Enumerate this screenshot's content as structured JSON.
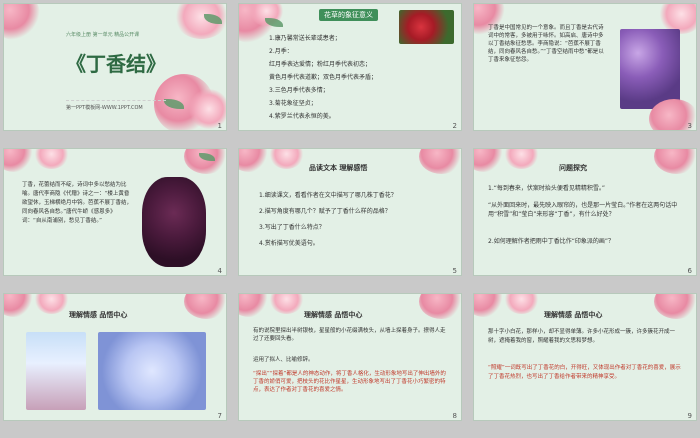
{
  "slides": {
    "s1": {
      "num": "1",
      "subtitle": "六年级上册 第一单元 精品公开课",
      "title": "《丁香结》",
      "footer": "第一PPT模板网-WWW.1PPT.COM"
    },
    "s2": {
      "num": "2",
      "tag": "花草的象征意义",
      "lines": [
        "1.康乃馨常送长辈或患者；",
        "2.月季：",
        "红月季表达爱情；粉红月季代表初恋；",
        "黄色月季代表道歉；双色月季代表矛盾；",
        "3.三色月季代表多情；",
        "3.菊花象征坚贞；",
        "4.紫罗兰代表永恒的美。"
      ]
    },
    "s3": {
      "num": "3",
      "text": "丁香是中国常见的一个意象。而且丁香是古代诗词中的常客，多被用于咏怀。如高启、唐诗中多以丁香结象征愁思。李商隐说：“芭蕉不展丁香结，同向春风各自愁。”“丁香空结雨中愁”都是以丁香来象征愁怨。"
    },
    "s4": {
      "num": "4",
      "text": "丁香，花蕾结而不绽，诗词中多以愁结为比喻。唐代李商隐《代赠》诗之一：“楼上黄昏欲望休，玉梯横绝月中钩。芭蕉不展丁香结，同向春风各自愁。”唐代牛峤《感恩多》词：“自从南浦别，愁见丁香结。”"
    },
    "s5": {
      "num": "5",
      "heading": "品读文本 理解感悟",
      "lines": [
        "1.细读课文，看看作者在文中描写了哪几株丁香花？",
        "2.描写角度有哪几个？赋予了丁香什么样的品格？",
        "3.写出了丁香什么特点？",
        "4.赏析描写优美语句。"
      ]
    },
    "s6": {
      "num": "6",
      "heading": "问题探究",
      "lines": [
        "1.“每到春来，伏案时抬头便看见精精积雪。”",
        "“从外面回来时，最先映入眼帘的，也是那一片莹白。”作者在这两句话中用“积雪”和“莹白”来形容“丁香”，有什么好处？",
        "2.如何理解作者把雨中丁香比作“印象派的画”？"
      ]
    },
    "s7": {
      "num": "7",
      "heading": "理解情感 品悟中心"
    },
    "s8": {
      "num": "8",
      "heading": "理解情感 品悟中心",
      "lines": [
        "有的说院里探出半树银枝，星星般的小花缀满枝头，从墙上探着身子。撩得人走过了还要回头看。",
        "运用了拟人、比喻修辞。",
        "“探出”“探着”都是人的神态动作，将丁香人格化，生动形象地写出了伸出墙外的丁香的娇俏可爱，把枝头的花比作星星，生动形象地写出了丁香花小巧繁密的特点，表达了作者对丁香花的喜爱之情。"
      ]
    },
    "s9": {
      "num": "9",
      "heading": "理解情感 品悟中心",
      "lines": [
        "那十字小白花，那样小，却不显得单薄。许多小花形成一簇，许多簇花开成一树，遮掩着我的窗，照耀着我的文思和梦想。",
        "“照耀”一词既写出了丁香花的白，开得旺，又体现出作者对丁香花的喜爱，展示了丁香花热烈，也写出了丁香给作者带来的精神享受。"
      ]
    }
  }
}
